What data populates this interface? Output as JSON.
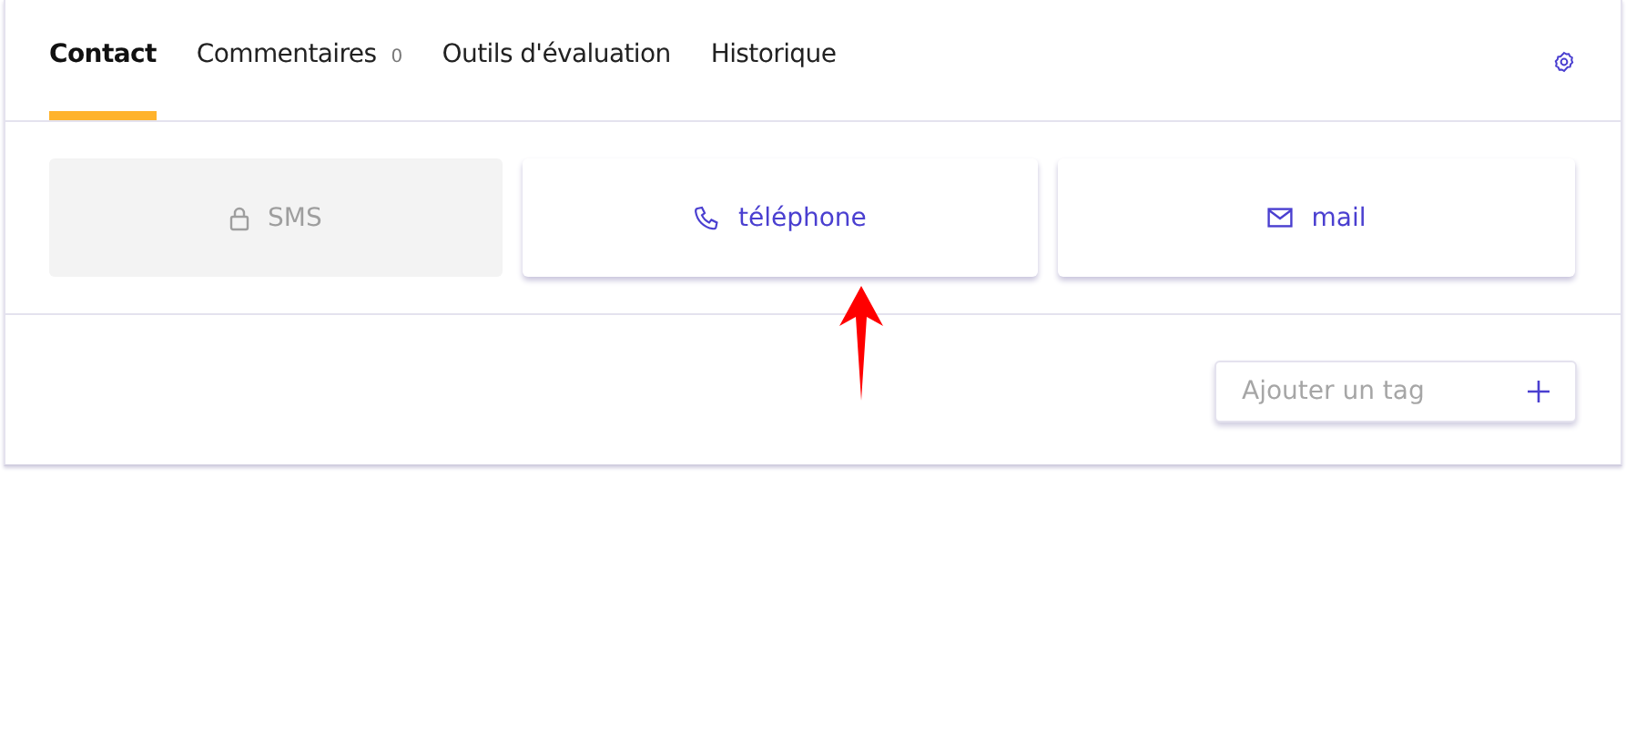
{
  "tabs": [
    {
      "label": "Contact",
      "selected": true
    },
    {
      "label": "Commentaires",
      "count": "0",
      "selected": false
    },
    {
      "label": "Outils d'évaluation",
      "selected": false
    },
    {
      "label": "Historique",
      "selected": false
    }
  ],
  "channels": [
    {
      "kind": "sms",
      "label": "SMS",
      "disabled": true
    },
    {
      "kind": "phone",
      "label": "téléphone",
      "disabled": false
    },
    {
      "kind": "mail",
      "label": "mail",
      "disabled": false
    }
  ],
  "tag_field": {
    "placeholder": "Ajouter un tag"
  },
  "annotation": {
    "kind": "arrow"
  }
}
